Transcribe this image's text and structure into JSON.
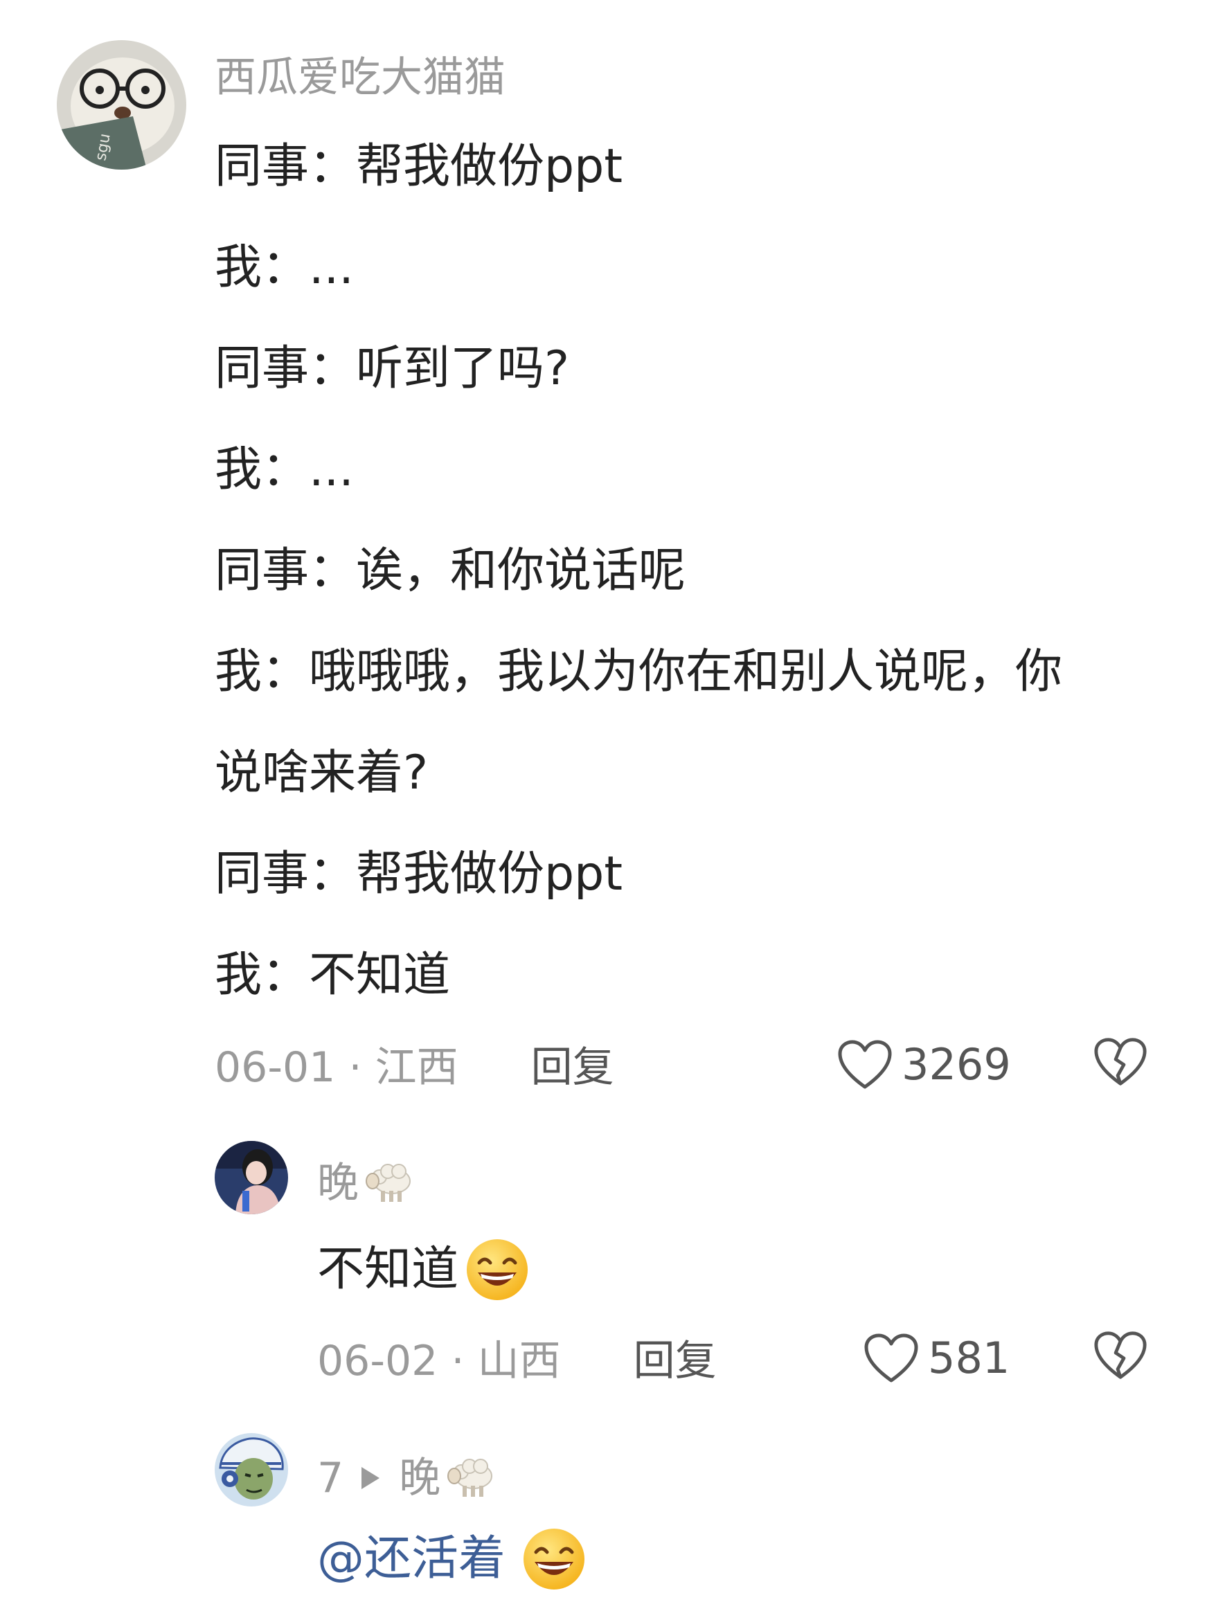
{
  "comment": {
    "username": "西瓜爱吃大猫猫",
    "lines": [
      "同事：帮我做份ppt",
      "我：...",
      "同事：听到了吗?",
      "我：...",
      "同事：诶，和你说话呢",
      "我：哦哦哦，我以为你在和别人说呢，你",
      "说啥来着?",
      "同事：帮我做份ppt",
      "我：不知道"
    ],
    "date": "06-01",
    "location": "江西",
    "reply_label": "回复",
    "likes": "3269",
    "avatar_icon": "bear-with-glasses-avatar"
  },
  "replies": [
    {
      "username": "晚",
      "username_icon": "sheep-emoji",
      "text": "不知道",
      "text_icon": "grinning-face-emoji",
      "date": "06-02",
      "location": "山西",
      "reply_label": "回复",
      "likes": "581"
    },
    {
      "username": "7",
      "reply_to": "晚",
      "reply_to_icon": "sheep-emoji",
      "text": "@还活着",
      "text_icon": "grinning-face-emoji"
    }
  ],
  "separator": "·",
  "colors": {
    "text": "#222222",
    "meta": "#9a9a9a",
    "mention": "#3d5e96"
  }
}
